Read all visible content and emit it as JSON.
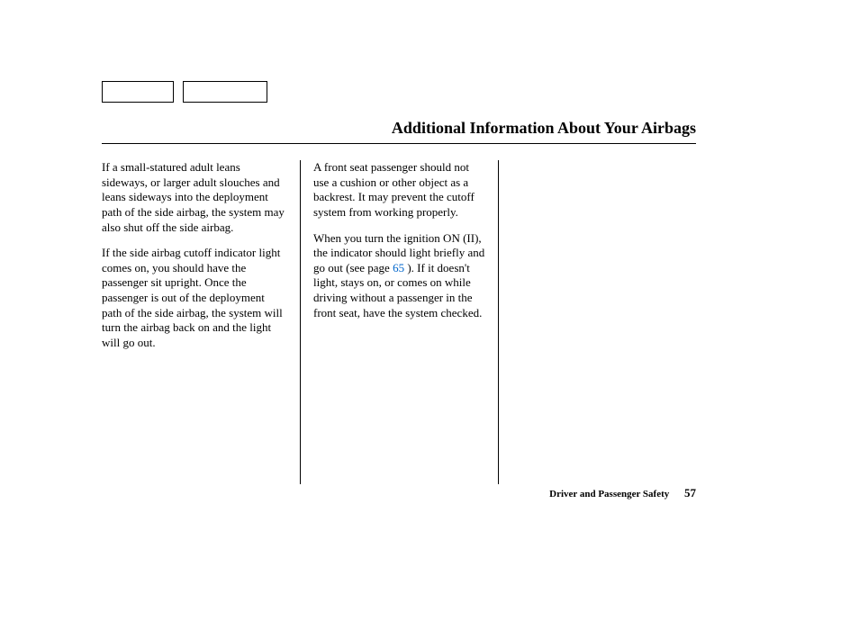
{
  "header": {
    "title": "Additional Information About Your Airbags"
  },
  "columns": {
    "col1": {
      "p1": "If a small-statured adult leans sideways, or larger adult slouches and leans sideways into the deployment path of the side airbag, the system may also shut off the side airbag.",
      "p2": "If the side airbag cutoff indicator light comes on, you should have the passenger sit upright. Once the passenger is out of the deployment path of the side airbag, the system will turn the airbag back on and the light will go out."
    },
    "col2": {
      "p1": "A front seat passenger should not use a cushion or other object as a backrest. It may prevent the cutoff system from working properly.",
      "p2a": "When you turn the ignition ON (II), the indicator should light briefly and go out (see page ",
      "p2_ref": "65",
      "p2b": " ). If it doesn't light, stays on, or comes on while driving without a passenger in the front seat, have the system checked."
    }
  },
  "footer": {
    "section": "Driver and Passenger Safety",
    "page": "57"
  }
}
